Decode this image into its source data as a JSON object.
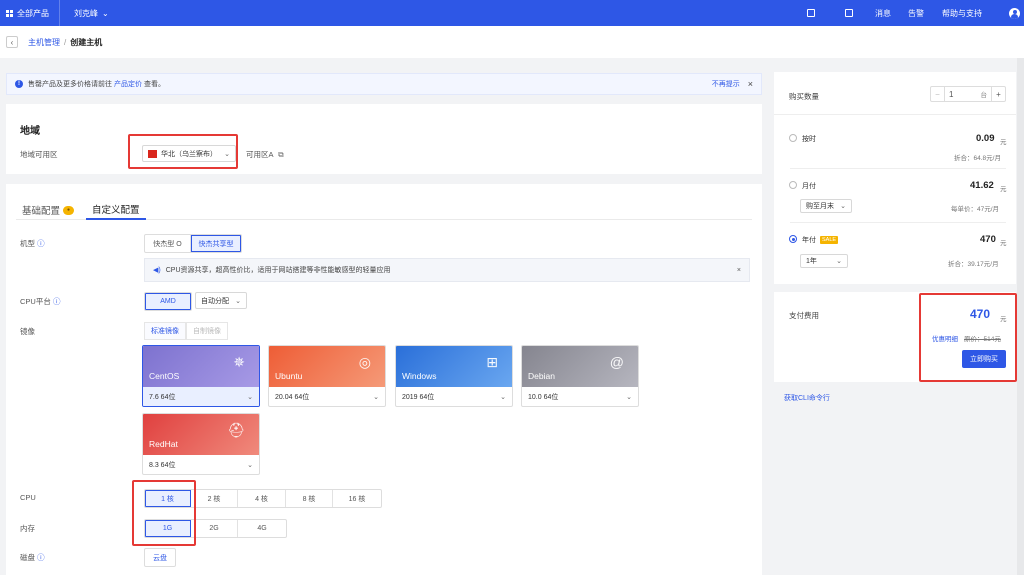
{
  "topbar": {
    "products": "全部产品",
    "user": "刘克峰",
    "messages": "消息",
    "alerts": "告警",
    "help": "帮助与支持"
  },
  "breadcrumb": {
    "parent": "主机管理",
    "sep": "/",
    "current": "创建主机"
  },
  "notice": {
    "text_prefix": "售罄产品及更多价格请前往",
    "link": "产品定价",
    "text_suffix": "查看。",
    "dismiss": "不再提示",
    "close": "×"
  },
  "region": {
    "title": "地域",
    "label": "地域可用区",
    "selected": "华北（乌兰察布）",
    "zone": "可用区A"
  },
  "config": {
    "tabs": [
      {
        "label": "基础配置"
      },
      {
        "label": "自定义配置"
      }
    ],
    "machine": {
      "label": "机型",
      "options": [
        "快杰型 O",
        "快杰共享型"
      ],
      "tip": "CPU资源共享，超高性价比，适用于网站搭建等非性能敏感型的轻量应用",
      "tip_close": "×"
    },
    "cpu_platform": {
      "label": "CPU平台",
      "option": "AMD",
      "select": "自动分配"
    },
    "image": {
      "label": "镜像",
      "tabs": [
        "标准镜像",
        "自制镜像"
      ],
      "os": [
        {
          "name": "CentOS",
          "version": "7.6 64位",
          "color": "#8a7fd6"
        },
        {
          "name": "Ubuntu",
          "version": "20.04 64位",
          "color": "#ef6a45"
        },
        {
          "name": "Windows",
          "version": "2019 64位",
          "color": "#2f7be0"
        },
        {
          "name": "Debian",
          "version": "10.0 64位",
          "color": "#8d8d98"
        },
        {
          "name": "RedHat",
          "version": "8.3 64位",
          "color": "#e4504d"
        }
      ]
    },
    "cpu": {
      "label": "CPU",
      "options": [
        "1 核",
        "2 核",
        "4 核",
        "8 核",
        "16 核"
      ]
    },
    "memory": {
      "label": "内存",
      "options": [
        "1G",
        "2G",
        "4G"
      ]
    },
    "disk": {
      "label": "磁盘",
      "option": "云盘"
    }
  },
  "order": {
    "quantity_label": "购买数量",
    "quantity_minus": "−",
    "quantity": "1",
    "quantity_unit": "台",
    "quantity_plus": "+",
    "hourly": {
      "label": "按时",
      "price": "0.09",
      "unit": "元",
      "discount": "折合：64.8元/月"
    },
    "monthly": {
      "label": "月付",
      "price": "41.62",
      "unit": "元",
      "select": "购至月末",
      "unit_price": "每单价：47元/月"
    },
    "yearly": {
      "label": "年付",
      "badge": "SALE",
      "price": "470",
      "unit": "元",
      "select": "1年",
      "discount": "折合：39.17元/月"
    },
    "pay": {
      "label": "支付费用",
      "price": "470",
      "unit": "元",
      "detail_link": "优惠明细",
      "original": "原价：514元",
      "buy": "立即购买"
    },
    "cli": "获取CLI命令行"
  }
}
